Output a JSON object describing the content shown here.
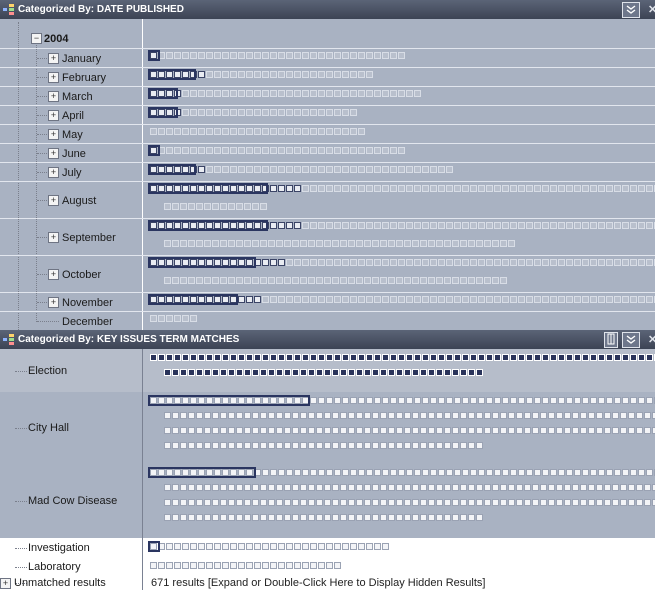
{
  "date_panel": {
    "title": "Categorized By: DATE PUBLISHED",
    "year": "2004",
    "months": [
      {
        "label": "January",
        "count": 1
      },
      {
        "label": "February",
        "count": 7
      },
      {
        "label": "March",
        "count": 4
      },
      {
        "label": "April",
        "count": 4
      },
      {
        "label": "May",
        "count": 0
      },
      {
        "label": "June",
        "count": 1
      },
      {
        "label": "July",
        "count": 7
      },
      {
        "label": "August",
        "count": 19
      },
      {
        "label": "September",
        "count": 19
      },
      {
        "label": "October",
        "count": 17
      },
      {
        "label": "November",
        "count": 14
      },
      {
        "label": "December",
        "count": 0
      }
    ]
  },
  "issues_panel": {
    "title": "Categorized By: KEY ISSUES TERM MATCHES",
    "categories": [
      {
        "label": "Election"
      },
      {
        "label": "City Hall"
      },
      {
        "label": "Mad Cow Disease"
      },
      {
        "label": "Investigation"
      },
      {
        "label": "Laboratory"
      },
      {
        "label": "Unmatched results"
      }
    ],
    "unmatched_status": "671 results [Expand or Double-Click Here to Display Hidden Results]"
  },
  "icons": {
    "panel_icon": "category-grid-icon",
    "collapse": "chevron-down-icon",
    "close": "close-icon",
    "expander": "plus-expander-icon",
    "column": "column-toggle-icon"
  },
  "colors": {
    "titlebar": "#3c4354",
    "panel_bg": "#a9b2c2",
    "cell_dark": "#29335a",
    "cell_light": "#f3f4f7"
  }
}
